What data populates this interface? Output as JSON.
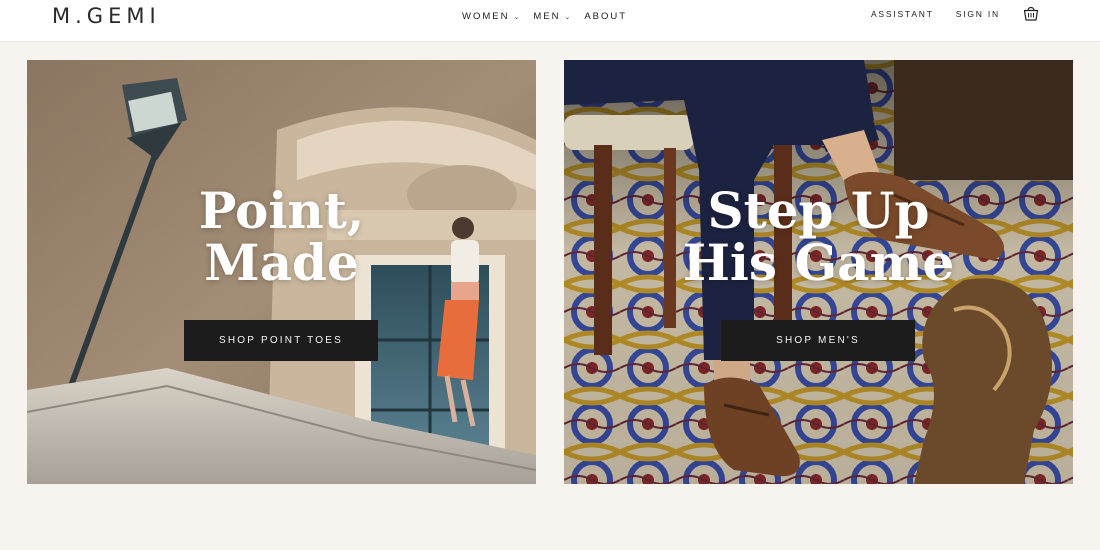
{
  "header": {
    "logo": "M.GEMI",
    "nav": [
      {
        "label": "WOMEN",
        "has_dropdown": true
      },
      {
        "label": "MEN",
        "has_dropdown": true
      },
      {
        "label": "ABOUT",
        "has_dropdown": false
      }
    ],
    "assistant_label": "ASSISTANT",
    "signin_label": "SIGN IN",
    "bag_icon": "shopping-bag-icon",
    "chevron_glyph": "⌄"
  },
  "tiles": [
    {
      "headline_line1": "Point,",
      "headline_line2": "Made",
      "cta_label": "SHOP POINT TOES"
    },
    {
      "headline_line1": "Step Up",
      "headline_line2": "His Game",
      "cta_label": "SHOP MEN'S"
    }
  ],
  "colors": {
    "page_bg": "#f7f4ef",
    "header_bg": "#ffffff",
    "cta_bg": "#1c1c1c",
    "cta_text": "#f5f5f5",
    "headline": "#ffffff"
  }
}
